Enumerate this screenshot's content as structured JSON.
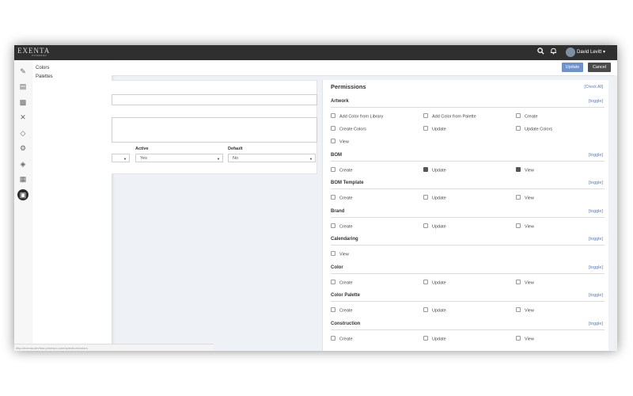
{
  "header": {
    "logo_main": "EXENTA",
    "logo_sub": "POWERED",
    "user_name": "David Levitt",
    "search_icon": "search-icon",
    "bell_icon": "bell-icon"
  },
  "menu": {
    "items": [
      {
        "label": "Colors"
      },
      {
        "label": "Palettes"
      }
    ]
  },
  "actions": {
    "update_label": "Update",
    "cancel_label": "Cancel"
  },
  "form": {
    "active_label": "Active",
    "active_value": "Yes",
    "default_label": "Default",
    "default_value": "No"
  },
  "permissions": {
    "title": "Permissions",
    "check_all": "[Check All]",
    "toggle_label": "[toggle]",
    "sections": [
      {
        "title": "Artwork",
        "options": [
          {
            "label": "Add Color from Library",
            "checked": false
          },
          {
            "label": "Add Color from Palette",
            "checked": false
          },
          {
            "label": "Create",
            "checked": false
          },
          {
            "label": "Create Colors",
            "checked": false
          },
          {
            "label": "Update",
            "checked": false
          },
          {
            "label": "Update Colors",
            "checked": false
          },
          {
            "label": "View",
            "checked": false
          }
        ]
      },
      {
        "title": "BOM",
        "options": [
          {
            "label": "Create",
            "checked": false
          },
          {
            "label": "Update",
            "checked": true
          },
          {
            "label": "View",
            "checked": true
          }
        ]
      },
      {
        "title": "BOM Template",
        "options": [
          {
            "label": "Create",
            "checked": false
          },
          {
            "label": "Update",
            "checked": false
          },
          {
            "label": "View",
            "checked": false
          }
        ]
      },
      {
        "title": "Brand",
        "options": [
          {
            "label": "Create",
            "checked": false
          },
          {
            "label": "Update",
            "checked": false
          },
          {
            "label": "View",
            "checked": false
          }
        ]
      },
      {
        "title": "Calendaring",
        "options": [
          {
            "label": "View",
            "checked": false
          }
        ]
      },
      {
        "title": "Color",
        "options": [
          {
            "label": "Create",
            "checked": false
          },
          {
            "label": "Update",
            "checked": false
          },
          {
            "label": "View",
            "checked": false
          }
        ]
      },
      {
        "title": "Color Palette",
        "options": [
          {
            "label": "Create",
            "checked": false
          },
          {
            "label": "Update",
            "checked": false
          },
          {
            "label": "View",
            "checked": false
          }
        ]
      },
      {
        "title": "Construction",
        "options": [
          {
            "label": "Create",
            "checked": false
          },
          {
            "label": "Update",
            "checked": false
          },
          {
            "label": "View",
            "checked": false
          }
        ]
      }
    ]
  },
  "status_url": "http://exenta.devflow.plmexpo.com/spectrum/colors"
}
